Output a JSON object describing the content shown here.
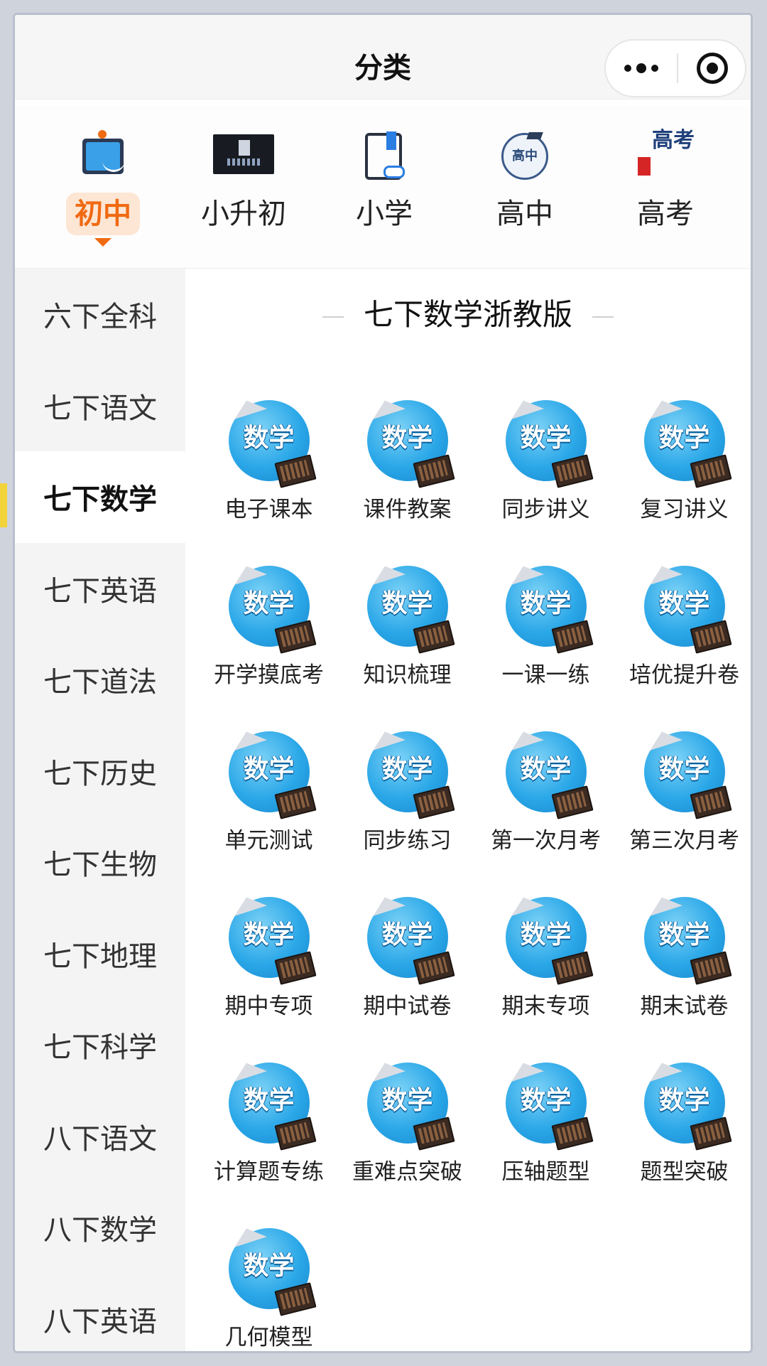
{
  "titlebar": {
    "title": "分类",
    "more_icon": "more-dots-icon",
    "close_icon": "target-circle-icon"
  },
  "top_categories": [
    {
      "label": "初中",
      "icon": "blackboard-icon",
      "active": true
    },
    {
      "label": "小升初",
      "icon": "promo-image-icon",
      "active": false
    },
    {
      "label": "小学",
      "icon": "book-link-icon",
      "active": false
    },
    {
      "label": "高中",
      "icon": "graduation-cap-icon",
      "icon_text": "高中",
      "active": false
    },
    {
      "label": "高考",
      "icon": "exam-icon",
      "icon_text": "高考",
      "active": false
    }
  ],
  "sidebar": {
    "items": [
      {
        "label": "六下全科"
      },
      {
        "label": "七下语文"
      },
      {
        "label": "七下数学",
        "active": true
      },
      {
        "label": "七下英语"
      },
      {
        "label": "七下道法"
      },
      {
        "label": "七下历史"
      },
      {
        "label": "七下生物"
      },
      {
        "label": "七下地理"
      },
      {
        "label": "七下科学"
      },
      {
        "label": "八下语文"
      },
      {
        "label": "八下数学"
      },
      {
        "label": "八下英语"
      }
    ]
  },
  "main": {
    "section_title": "七下数学浙教版",
    "icon_text": "数学",
    "items": [
      {
        "label": "电子课本"
      },
      {
        "label": "课件教案"
      },
      {
        "label": "同步讲义"
      },
      {
        "label": "复习讲义"
      },
      {
        "label": "开学摸底考"
      },
      {
        "label": "知识梳理"
      },
      {
        "label": "一课一练"
      },
      {
        "label": "培优提升卷"
      },
      {
        "label": "单元测试"
      },
      {
        "label": "同步练习"
      },
      {
        "label": "第一次月考"
      },
      {
        "label": "第三次月考"
      },
      {
        "label": "期中专项"
      },
      {
        "label": "期中试卷"
      },
      {
        "label": "期末专项"
      },
      {
        "label": "期末试卷"
      },
      {
        "label": "计算题专练"
      },
      {
        "label": "重难点突破"
      },
      {
        "label": "压轴题型"
      },
      {
        "label": "题型突破"
      },
      {
        "label": "几何模型"
      }
    ]
  },
  "colors": {
    "accent": "#f06a12",
    "accent_bg": "#fde6d4",
    "sidebar_bg": "#f4f4f4",
    "active_marker": "#f3d33a",
    "icon_blue": "#2aa7e8"
  }
}
